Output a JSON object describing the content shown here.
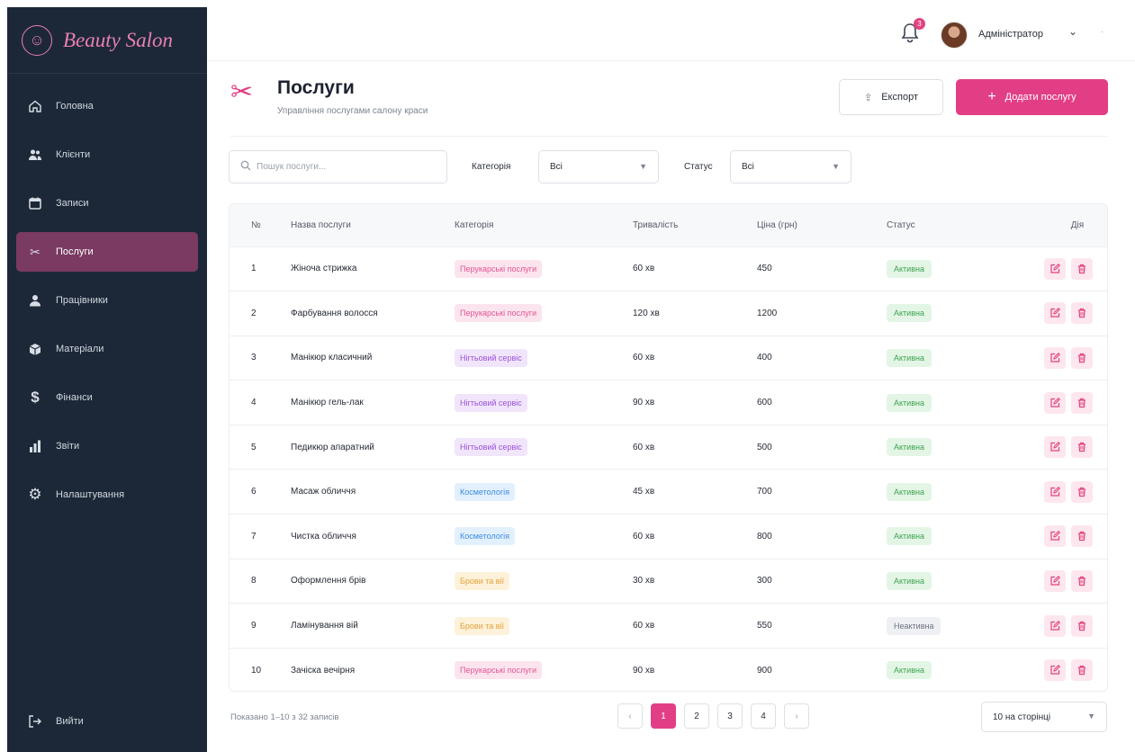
{
  "app": {
    "brand": "Beauty Salon",
    "brand_icon": "woman-face-icon"
  },
  "sidebar": {
    "items": [
      {
        "label": "Головна",
        "icon": "home-icon"
      },
      {
        "label": "Клієнти",
        "icon": "users-icon"
      },
      {
        "label": "Записи",
        "icon": "calendar-icon"
      },
      {
        "label": "Послуги",
        "icon": "scissors-icon",
        "active": true
      },
      {
        "label": "Працівники",
        "icon": "worker-icon"
      },
      {
        "label": "Матеріали",
        "icon": "box-icon"
      },
      {
        "label": "Фінанси",
        "icon": "dollar-icon"
      },
      {
        "label": "Звіти",
        "icon": "bar-chart-icon"
      },
      {
        "label": "Налаштування",
        "icon": "gear-icon"
      }
    ],
    "logout": "Вийти"
  },
  "topbar": {
    "notifications": "3",
    "user": "Адміністратор"
  },
  "page": {
    "title": "Послуги",
    "subtitle": "Управління послугами салону краси"
  },
  "actions": {
    "export": "Експорт",
    "add": "Додати послугу"
  },
  "filters": {
    "search_placeholder": "Пошук послуги...",
    "category_label": "Категорія",
    "category_value": "Всі",
    "status_label": "Статус",
    "status_value": "Всі"
  },
  "table": {
    "columns": [
      "№",
      "Назва послуги",
      "Категорія",
      "Тривалість",
      "Ціна (грн)",
      "Статус",
      "Дія"
    ],
    "rows": [
      {
        "n": "1",
        "name": "Жіноча стрижка",
        "category": "Перукарські послуги",
        "cat": "pink",
        "duration": "60 хв",
        "price": "450",
        "status": "Активна",
        "active": true
      },
      {
        "n": "2",
        "name": "Фарбування волосся",
        "category": "Перукарські послуги",
        "cat": "pink",
        "duration": "120 хв",
        "price": "1200",
        "status": "Активна",
        "active": true
      },
      {
        "n": "3",
        "name": "Манікюр класичний",
        "category": "Нігтьовий сервіс",
        "cat": "purple",
        "duration": "60 хв",
        "price": "400",
        "status": "Активна",
        "active": true
      },
      {
        "n": "4",
        "name": "Манікюр гель-лак",
        "category": "Нігтьовий сервіс",
        "cat": "purple",
        "duration": "90 хв",
        "price": "600",
        "status": "Активна",
        "active": true
      },
      {
        "n": "5",
        "name": "Педикюр апаратний",
        "category": "Нігтьовий сервіс",
        "cat": "purple",
        "duration": "60 хв",
        "price": "500",
        "status": "Активна",
        "active": true
      },
      {
        "n": "6",
        "name": "Масаж обличчя",
        "category": "Косметологія",
        "cat": "blue",
        "duration": "45 хв",
        "price": "700",
        "status": "Активна",
        "active": true
      },
      {
        "n": "7",
        "name": "Чистка обличчя",
        "category": "Косметологія",
        "cat": "blue",
        "duration": "60 хв",
        "price": "800",
        "status": "Активна",
        "active": true
      },
      {
        "n": "8",
        "name": "Оформлення брів",
        "category": "Брови та вії",
        "cat": "yellow",
        "duration": "30 хв",
        "price": "300",
        "status": "Активна",
        "active": true
      },
      {
        "n": "9",
        "name": "Ламінування вій",
        "category": "Брови та вії",
        "cat": "yellow",
        "duration": "60 хв",
        "price": "550",
        "status": "Неактивна",
        "active": false
      },
      {
        "n": "10",
        "name": "Зачіска вечірня",
        "category": "Перукарські послуги",
        "cat": "pink",
        "duration": "90 хв",
        "price": "900",
        "status": "Активна",
        "active": true
      }
    ]
  },
  "footer": {
    "info": "Показано 1–10 з 32 записів",
    "pages": [
      "1",
      "2",
      "3",
      "4"
    ],
    "current_page": "1",
    "per_page": "10 на сторінці"
  },
  "colors": {
    "accent": "#e23e86",
    "sidebar": "#1c2838",
    "sidebar_active": "#7a3a62"
  }
}
